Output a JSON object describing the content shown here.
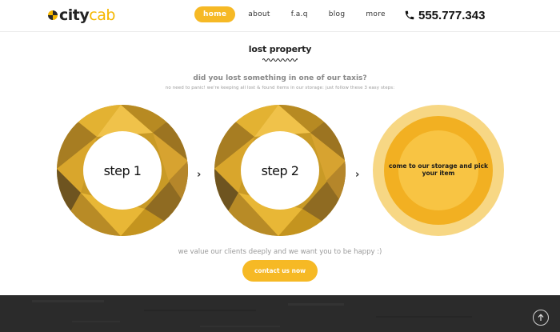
{
  "header": {
    "logo": {
      "city": "city",
      "cab": "cab"
    },
    "nav": [
      {
        "label": "home",
        "active": true
      },
      {
        "label": "about",
        "active": false
      },
      {
        "label": "f.a.q",
        "active": false
      },
      {
        "label": "blog",
        "active": false
      },
      {
        "label": "more",
        "active": false
      }
    ],
    "phone": {
      "icon": "phone-icon",
      "number": "555.777.343"
    }
  },
  "main": {
    "title": "lost property",
    "question": "did you lost something in one of our taxis?",
    "subtext": "no need to panic! we're keeping all lost & found items in our storage: just follow these 3 easy steps:",
    "steps": [
      {
        "label": "step 1"
      },
      {
        "label": "step 2"
      },
      {
        "label": "come to our storage and pick your item"
      }
    ],
    "step_arrow": "›",
    "closing": "we value our clients deeply and we want you to be happy :)",
    "contact_button": "contact us now"
  },
  "footer": {
    "to_top_icon": "arrow-up-icon"
  },
  "colors": {
    "accent": "#f6b925",
    "ring_dark": "#8a6a24",
    "ring_light": "#e9b230",
    "footer": "#2b2b2b"
  }
}
